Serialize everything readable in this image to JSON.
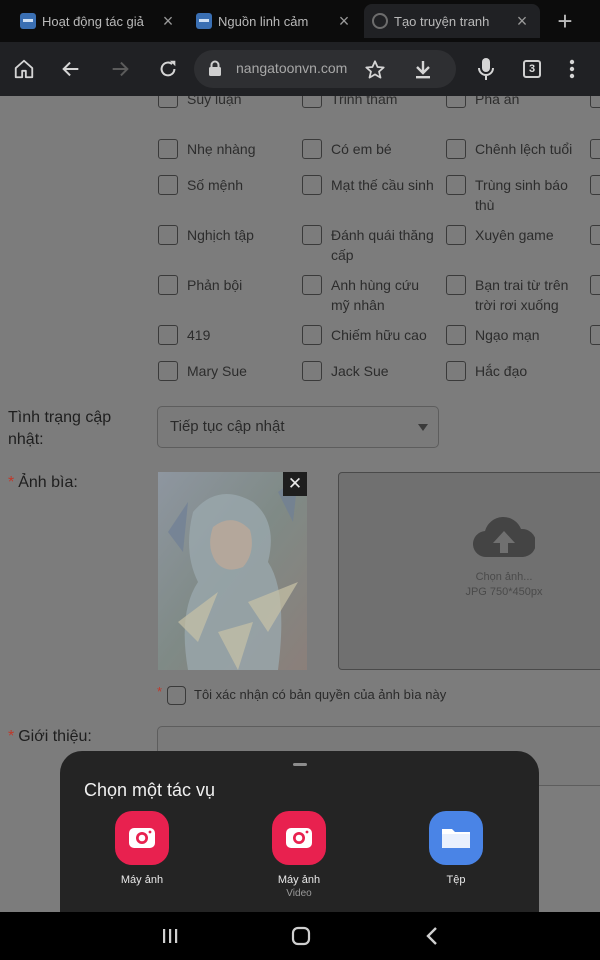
{
  "tabs": [
    {
      "title": "Hoạt động tác giả",
      "favicon": "site-icon",
      "active": false
    },
    {
      "title": "Nguồn linh cảm",
      "favicon": "site-icon",
      "active": false
    },
    {
      "title": "Tạo truyện tranh",
      "favicon": "globe-icon",
      "active": true
    }
  ],
  "toolbar": {
    "url": "nangatoonvn.com",
    "tab_count": "3"
  },
  "tags": [
    {
      "label": "Suy luận"
    },
    {
      "label": "Trinh thám"
    },
    {
      "label": "Phá án"
    },
    {
      "label": "Nhẹ nhàng"
    },
    {
      "label": "Có em bé"
    },
    {
      "label": "Chênh lệch tuổi"
    },
    {
      "label": "Số mệnh"
    },
    {
      "label": "Mạt thế cầu sinh"
    },
    {
      "label": "Trùng sinh báo thù"
    },
    {
      "label": "Nghịch tập"
    },
    {
      "label": "Đánh quái thăng cấp"
    },
    {
      "label": "Xuyên game"
    },
    {
      "label": "Phản bội"
    },
    {
      "label": "Anh hùng cứu mỹ nhân"
    },
    {
      "label": "Bạn trai từ trên trời rơi xuống"
    },
    {
      "label": "419"
    },
    {
      "label": "Chiếm hữu cao"
    },
    {
      "label": "Ngạo mạn"
    },
    {
      "label": "Mary Sue"
    },
    {
      "label": "Jack Sue"
    },
    {
      "label": "Hắc đạo"
    }
  ],
  "form": {
    "status_label": "Tình trạng cập nhật:",
    "status_value": "Tiếp tục cập nhật",
    "cover_label": "Ảnh bìa:",
    "cover_close": "✕",
    "upload_line1": "Chọn ảnh...",
    "upload_line2": "JPG 750*450px",
    "confirm_label": "Tôi xác nhận có bản quyền của ảnh bìa này",
    "intro_label": "Giới thiệu:",
    "required_mark": "*"
  },
  "sheet": {
    "title": "Chọn một tác vụ",
    "actions": [
      {
        "label": "Máy ảnh",
        "sub": "",
        "icon": "camera-icon"
      },
      {
        "label": "Máy ảnh",
        "sub": "Video",
        "icon": "camera-icon"
      },
      {
        "label": "Tệp",
        "sub": "",
        "icon": "folder-icon"
      }
    ]
  },
  "colors": {
    "camera": "#e8214f",
    "files": "#4a84e6",
    "required": "#c0392b"
  }
}
